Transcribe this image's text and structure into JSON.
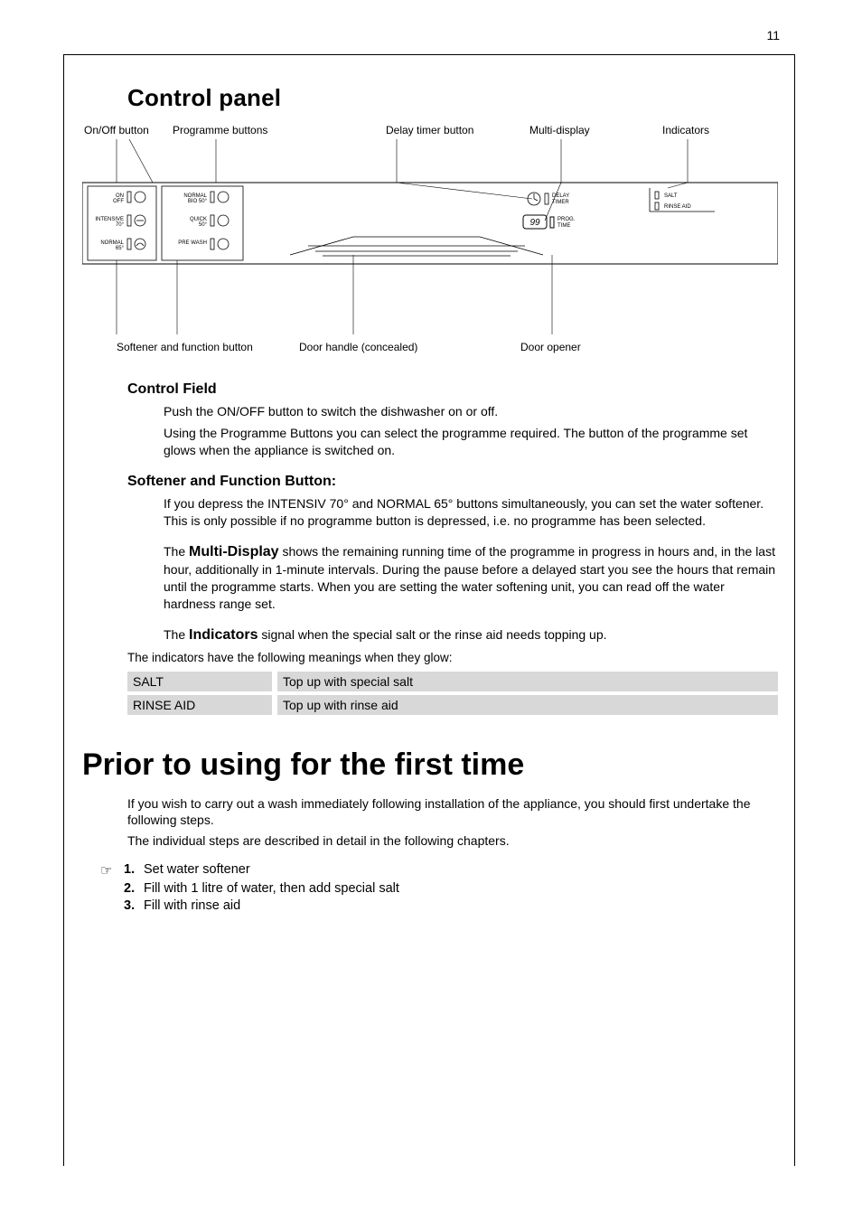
{
  "page_number": "11",
  "headings": {
    "control_panel": "Control panel",
    "prior": "Prior to using for the first time"
  },
  "diagram_labels": {
    "on_off": "On/Off button",
    "programme": "Programme buttons",
    "delay_timer": "Delay timer button",
    "multi_display": "Multi-display",
    "indicators": "Indicators",
    "softener_fn": "Softener and function button",
    "handle": "Door handle (concealed)",
    "door_opener": "Door opener"
  },
  "panel": {
    "col1": [
      {
        "label": "ON\nOFF"
      },
      {
        "label": "INTENSIVE\n70°"
      },
      {
        "label": "NORMAL\n65°"
      }
    ],
    "col2": [
      {
        "label": "NORMAL\nBIO 50°"
      },
      {
        "label": "QUICK\n50°"
      },
      {
        "label": "PRE WASH"
      }
    ],
    "delay": "DELAY\nTIMER",
    "prog_time": "PROG.\nTIME",
    "prog_value": "99",
    "salt": "SALT",
    "rinse": "RINSE AID"
  },
  "control_field": {
    "title": "Control Field",
    "on_off": "Push the ON/OFF button to switch the dishwasher on or off.",
    "prog_para": "Using the Programme Buttons you can select the programme required. The button of the programme set glows when the appliance is switched on.",
    "softener_title": "Softener and Function Button:",
    "softener_body": "If you depress the INTENSIV 70° and NORMAL 65° buttons simultaneously, you can set the water softener. This is only possible if no programme button is depressed, i.e. no programme has been selected.",
    "multi_title": "Multi-Display",
    "multi_body": " shows the remaining running time of the programme in progress in hours and, in the last hour, additionally in 1-minute intervals. During the pause before a delayed start you see the hours that remain until the programme starts. When you are setting the water softening unit, you can read off the water hardness range set.",
    "indicators_title": "Indicators",
    "indicators_note": "The indicators have the following meanings when they glow:"
  },
  "indicator_table": [
    {
      "k": "SALT",
      "v": "Top up with special salt"
    },
    {
      "k": "RINSE AID",
      "v": "Top up with rinse aid"
    }
  ],
  "prior_intro1": "If you wish to carry out a wash immediately following installation of the appliance, you should first undertake the following steps.",
  "prior_intro2": "The individual steps are described in detail in the following chapters.",
  "steps": [
    "Set water softener",
    "Fill with 1 litre of water, then add special salt",
    "Fill with rinse aid"
  ]
}
